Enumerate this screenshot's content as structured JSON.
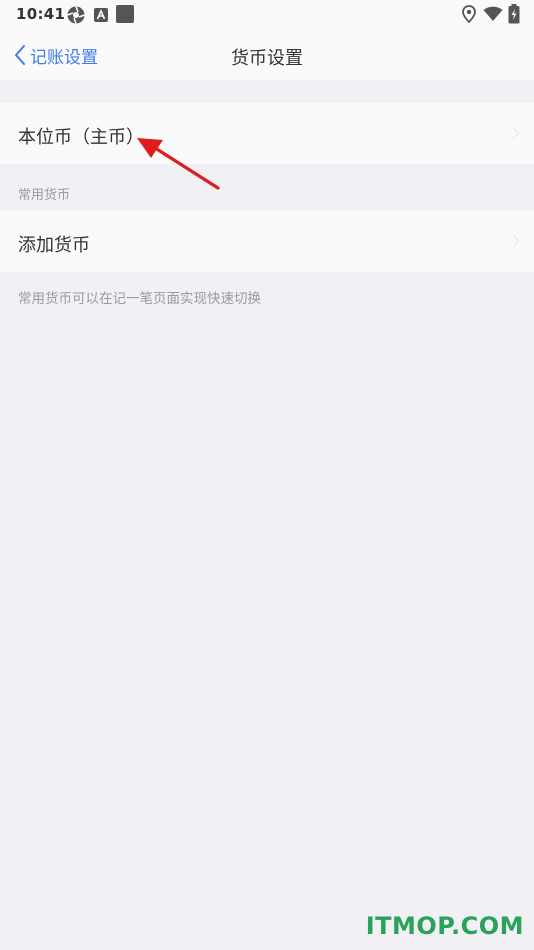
{
  "status_bar": {
    "time": "10:41",
    "icons": [
      "aperture-icon",
      "a-letter-icon",
      "square-icon",
      "location-icon",
      "wifi-icon",
      "battery-charging-icon"
    ]
  },
  "nav": {
    "back_label": "记账设置",
    "title": "货币设置"
  },
  "base_currency": {
    "label": "本位币（主币）"
  },
  "common_section": {
    "header": "常用货币",
    "add_label": "添加货币",
    "footer": "常用货币可以在记一笔页面实现快速切换"
  },
  "annotation": {
    "arrow_color": "#e01b1b"
  },
  "watermark": {
    "text": "ITMOP.COM"
  },
  "colors": {
    "accent": "#3f7ce8",
    "background": "#f1f0f5",
    "cell": "#fafafa",
    "muted_text": "#9a9a9f",
    "watermark": "#2aa35a"
  }
}
